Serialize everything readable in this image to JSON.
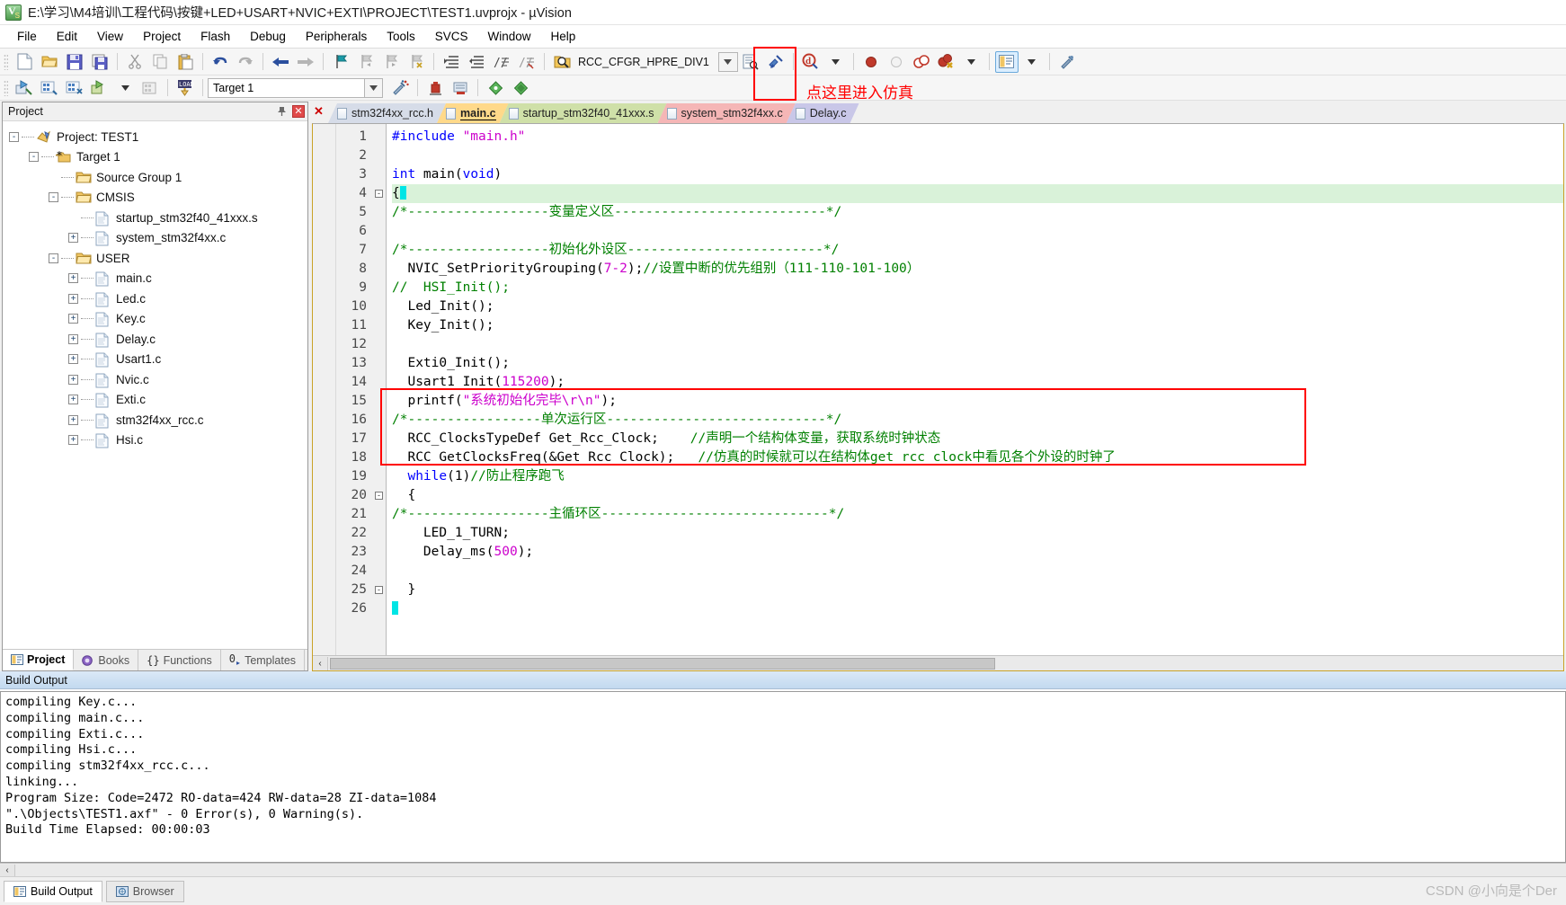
{
  "window": {
    "title": "E:\\学习\\M4培训\\工程代码\\按键+LED+USART+NVIC+EXTI\\PROJECT\\TEST1.uvprojx - µVision",
    "app_icon": "uvision-icon"
  },
  "menu": {
    "items": [
      "File",
      "Edit",
      "View",
      "Project",
      "Flash",
      "Debug",
      "Peripherals",
      "Tools",
      "SVCS",
      "Window",
      "Help"
    ]
  },
  "toolbar1": {
    "buttons": [
      {
        "name": "new-file-icon",
        "glyph": "new"
      },
      {
        "name": "open-file-icon",
        "glyph": "open"
      },
      {
        "name": "save-icon",
        "glyph": "save"
      },
      {
        "name": "save-all-icon",
        "glyph": "saveall"
      },
      {
        "name": "cut-icon",
        "glyph": "cut"
      },
      {
        "name": "copy-icon",
        "glyph": "copy"
      },
      {
        "name": "paste-icon",
        "glyph": "paste"
      },
      {
        "name": "undo-icon",
        "glyph": "undo"
      },
      {
        "name": "redo-icon",
        "glyph": "redo"
      },
      {
        "name": "navigate-back-icon",
        "glyph": "back"
      },
      {
        "name": "navigate-forward-icon",
        "glyph": "forward"
      },
      {
        "name": "bookmark-toggle-icon",
        "glyph": "bm"
      },
      {
        "name": "bookmark-prev-icon",
        "glyph": "bmprev"
      },
      {
        "name": "bookmark-next-icon",
        "glyph": "bmnext"
      },
      {
        "name": "bookmark-clear-icon",
        "glyph": "bmclear"
      },
      {
        "name": "indent-icon",
        "glyph": "indent"
      },
      {
        "name": "outdent-icon",
        "glyph": "outdent"
      },
      {
        "name": "comment-icon",
        "glyph": "comment"
      },
      {
        "name": "uncomment-icon",
        "glyph": "uncomment"
      }
    ],
    "symbol_combo_value": "RCC_CFGR_HPRE_DIV1",
    "breakpoint_buttons": [
      {
        "name": "insert-breakpoint-icon"
      },
      {
        "name": "disable-breakpoint-icon"
      },
      {
        "name": "disable-all-breakpoints-icon"
      },
      {
        "name": "kill-all-breakpoints-icon"
      }
    ],
    "debug_button": {
      "name": "start-stop-debug-session-button",
      "tooltip": "Start/Stop Debug Session"
    }
  },
  "toolbar2": {
    "target_value": "Target 1",
    "buttons": [
      {
        "name": "translate-icon"
      },
      {
        "name": "build-icon"
      },
      {
        "name": "rebuild-icon"
      },
      {
        "name": "batch-build-icon"
      },
      {
        "name": "stop-build-icon"
      },
      {
        "name": "download-icon"
      },
      {
        "name": "target-options-icon"
      },
      {
        "name": "manage-run-time-env-icon"
      },
      {
        "name": "configuration-wizard-icon"
      },
      {
        "name": "multi-project-icon"
      },
      {
        "name": "book-icon"
      },
      {
        "name": "components-icon"
      }
    ]
  },
  "annotation": {
    "text": "点这里进入仿真",
    "color": "#ff0000"
  },
  "project_panel": {
    "title": "Project",
    "pin_icon": "pin-icon",
    "close_icon": "close-icon",
    "tree": [
      {
        "label": "Project: TEST1",
        "level": 0,
        "expander": "-",
        "icon": "project-icon"
      },
      {
        "label": "Target 1",
        "level": 1,
        "expander": "-",
        "icon": "target-icon"
      },
      {
        "label": "Source Group 1",
        "level": 2,
        "expander": "",
        "icon": "folder-icon"
      },
      {
        "label": "CMSIS",
        "level": 2,
        "expander": "-",
        "icon": "folder-icon"
      },
      {
        "label": "startup_stm32f40_41xxx.s",
        "level": 3,
        "expander": "",
        "icon": "file-icon"
      },
      {
        "label": "system_stm32f4xx.c",
        "level": 3,
        "expander": "+",
        "icon": "file-icon"
      },
      {
        "label": "USER",
        "level": 2,
        "expander": "-",
        "icon": "folder-icon"
      },
      {
        "label": "main.c",
        "level": 3,
        "expander": "+",
        "icon": "file-icon"
      },
      {
        "label": "Led.c",
        "level": 3,
        "expander": "+",
        "icon": "file-icon"
      },
      {
        "label": "Key.c",
        "level": 3,
        "expander": "+",
        "icon": "file-icon"
      },
      {
        "label": "Delay.c",
        "level": 3,
        "expander": "+",
        "icon": "file-icon"
      },
      {
        "label": "Usart1.c",
        "level": 3,
        "expander": "+",
        "icon": "file-icon"
      },
      {
        "label": "Nvic.c",
        "level": 3,
        "expander": "+",
        "icon": "file-icon"
      },
      {
        "label": "Exti.c",
        "level": 3,
        "expander": "+",
        "icon": "file-icon"
      },
      {
        "label": "stm32f4xx_rcc.c",
        "level": 3,
        "expander": "+",
        "icon": "file-icon"
      },
      {
        "label": "Hsi.c",
        "level": 3,
        "expander": "+",
        "icon": "file-icon"
      }
    ],
    "tabs": [
      {
        "label": "Project",
        "selected": true,
        "icon": "project-tab-icon"
      },
      {
        "label": "Books",
        "selected": false,
        "icon": "books-tab-icon"
      },
      {
        "label": "Functions",
        "selected": false,
        "icon": "functions-tab-icon"
      },
      {
        "label": "Templates",
        "selected": false,
        "icon": "templates-tab-icon"
      }
    ]
  },
  "editor": {
    "tabs": [
      {
        "label": "stm32f4xx_rcc.h",
        "color": "#d6dce8",
        "selected": false
      },
      {
        "label": "main.c",
        "color": "#ffd98a",
        "selected": true
      },
      {
        "label": "startup_stm32f40_41xxx.s",
        "color": "#cfe0a8",
        "selected": false
      },
      {
        "label": "system_stm32f4xx.c",
        "color": "#f5b6b6",
        "selected": false
      },
      {
        "label": "Delay.c",
        "color": "#c9c7e8",
        "selected": false
      }
    ],
    "lines": [
      {
        "n": 1,
        "fold": "",
        "highlight": false,
        "tokens": [
          {
            "t": "#include ",
            "c": "k"
          },
          {
            "t": "\"main.h\"",
            "c": "s"
          }
        ]
      },
      {
        "n": 2,
        "fold": "",
        "highlight": false,
        "tokens": []
      },
      {
        "n": 3,
        "fold": "",
        "highlight": false,
        "tokens": [
          {
            "t": "int",
            "c": "k"
          },
          {
            "t": " main(",
            "c": ""
          },
          {
            "t": "void",
            "c": "k"
          },
          {
            "t": ")",
            "c": ""
          }
        ]
      },
      {
        "n": 4,
        "fold": "-",
        "highlight": true,
        "tokens": [
          {
            "t": "{",
            "c": ""
          },
          {
            "t": "|CURSOR|",
            "c": ""
          }
        ]
      },
      {
        "n": 5,
        "fold": "",
        "highlight": false,
        "tokens": [
          {
            "t": "/*------------------变量定义区---------------------------*/",
            "c": "c"
          }
        ]
      },
      {
        "n": 6,
        "fold": "",
        "highlight": false,
        "tokens": []
      },
      {
        "n": 7,
        "fold": "",
        "highlight": false,
        "tokens": [
          {
            "t": "/*------------------初始化外设区-------------------------*/",
            "c": "c"
          }
        ]
      },
      {
        "n": 8,
        "fold": "",
        "highlight": false,
        "tokens": [
          {
            "t": "  NVIC_SetPriorityGrouping(",
            "c": ""
          },
          {
            "t": "7-2",
            "c": "n"
          },
          {
            "t": ");",
            "c": ""
          },
          {
            "t": "//设置中断的优先组别（111-110-101-100）",
            "c": "c"
          }
        ]
      },
      {
        "n": 9,
        "fold": "",
        "highlight": false,
        "tokens": [
          {
            "t": "//  HSI_Init();",
            "c": "c"
          }
        ]
      },
      {
        "n": 10,
        "fold": "",
        "highlight": false,
        "tokens": [
          {
            "t": "  Led_Init();",
            "c": ""
          }
        ]
      },
      {
        "n": 11,
        "fold": "",
        "highlight": false,
        "tokens": [
          {
            "t": "  Key_Init();",
            "c": ""
          }
        ]
      },
      {
        "n": 12,
        "fold": "",
        "highlight": false,
        "tokens": []
      },
      {
        "n": 13,
        "fold": "",
        "highlight": false,
        "tokens": [
          {
            "t": "  Exti0_Init();",
            "c": ""
          }
        ]
      },
      {
        "n": 14,
        "fold": "",
        "highlight": false,
        "tokens": [
          {
            "t": "  Usart1_Init(",
            "c": ""
          },
          {
            "t": "115200",
            "c": "n"
          },
          {
            "t": ");",
            "c": ""
          }
        ]
      },
      {
        "n": 15,
        "fold": "",
        "highlight": false,
        "tokens": [
          {
            "t": "  printf(",
            "c": ""
          },
          {
            "t": "\"系统初始化完毕\\r\\n\"",
            "c": "s"
          },
          {
            "t": ");",
            "c": ""
          }
        ]
      },
      {
        "n": 16,
        "fold": "",
        "highlight": false,
        "tokens": [
          {
            "t": "/*-----------------单次运行区----------------------------*/",
            "c": "c"
          }
        ]
      },
      {
        "n": 17,
        "fold": "",
        "highlight": false,
        "tokens": [
          {
            "t": "  RCC_ClocksTypeDef Get_Rcc_Clock;    ",
            "c": ""
          },
          {
            "t": "//声明一个结构体变量，获取系统时钟状态",
            "c": "c"
          }
        ]
      },
      {
        "n": 18,
        "fold": "",
        "highlight": false,
        "tokens": [
          {
            "t": "  RCC_GetClocksFreq(&Get_Rcc_Clock);   ",
            "c": ""
          },
          {
            "t": "//仿真的时候就可以在结构体get_rcc_clock中看见各个外设的时钟了",
            "c": "c"
          }
        ]
      },
      {
        "n": 19,
        "fold": "",
        "highlight": false,
        "tokens": [
          {
            "t": "  while",
            "c": "k"
          },
          {
            "t": "(1)",
            "c": ""
          },
          {
            "t": "//防止程序跑飞",
            "c": "c"
          }
        ]
      },
      {
        "n": 20,
        "fold": "-",
        "highlight": false,
        "tokens": [
          {
            "t": "  {",
            "c": ""
          }
        ]
      },
      {
        "n": 21,
        "fold": "",
        "highlight": false,
        "tokens": [
          {
            "t": "/*------------------主循环区-----------------------------*/",
            "c": "c"
          }
        ]
      },
      {
        "n": 22,
        "fold": "",
        "highlight": false,
        "tokens": [
          {
            "t": "    LED_1_TURN;",
            "c": ""
          }
        ]
      },
      {
        "n": 23,
        "fold": "",
        "highlight": false,
        "tokens": [
          {
            "t": "    Delay_ms(",
            "c": ""
          },
          {
            "t": "500",
            "c": "n"
          },
          {
            "t": ");",
            "c": ""
          }
        ]
      },
      {
        "n": 24,
        "fold": "",
        "highlight": false,
        "tokens": []
      },
      {
        "n": 25,
        "fold": "-",
        "highlight": false,
        "tokens": [
          {
            "t": "  }",
            "c": ""
          }
        ]
      },
      {
        "n": 26,
        "fold": "",
        "highlight": false,
        "tokens": [
          {
            "t": "|CURSOR|",
            "c": ""
          }
        ]
      }
    ]
  },
  "build_output": {
    "title": "Build Output",
    "lines": [
      "compiling Key.c...",
      "compiling main.c...",
      "compiling Exti.c...",
      "compiling Hsi.c...",
      "compiling stm32f4xx_rcc.c...",
      "linking...",
      "Program Size: Code=2472 RO-data=424 RW-data=28 ZI-data=1084",
      "\".\\Objects\\TEST1.axf\" - 0 Error(s), 0 Warning(s).",
      "Build Time Elapsed:  00:00:03"
    ]
  },
  "bottom_tabs": [
    {
      "label": "Build Output",
      "selected": true,
      "icon": "build-output-icon"
    },
    {
      "label": "Browser",
      "selected": false,
      "icon": "browser-icon"
    }
  ],
  "watermark": "CSDN @小向是个Der"
}
